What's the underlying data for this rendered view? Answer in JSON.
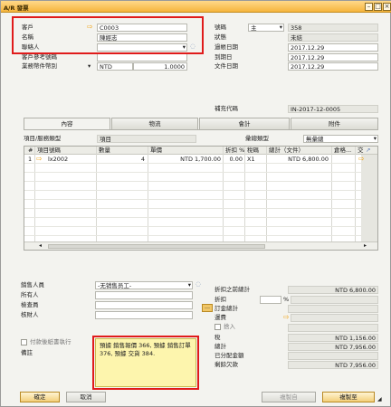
{
  "window": {
    "title": "A/R 發票"
  },
  "header_left": [
    {
      "label": "客戶",
      "value": "C0003"
    },
    {
      "label": "名稱",
      "value": "陳經志"
    },
    {
      "label": "聯絡人",
      "value": ""
    },
    {
      "label": "客戶參考號碼",
      "value": ""
    },
    {
      "label": "業務幣件幣別",
      "currency": "NTD",
      "rate": "1.0000"
    }
  ],
  "header_right": [
    {
      "label": "號碼",
      "series": "主",
      "value": "358"
    },
    {
      "label": "狀態",
      "value": "未結"
    },
    {
      "label": "過帳日期",
      "value": "2017.12.29"
    },
    {
      "label": "到期日",
      "value": "2017.12.29"
    },
    {
      "label": "文件日期",
      "value": "2017.12.29"
    }
  ],
  "reference": {
    "label": "補充代碼",
    "value": "IN-2017-12-0005"
  },
  "tabs": [
    "內容",
    "物流",
    "會計",
    "附件"
  ],
  "item_row": {
    "type_label": "項目/服務類型",
    "type_value": "項目",
    "summary_label": "彙總類型",
    "summary_value": "無彙總"
  },
  "grid": {
    "columns": [
      "#",
      "項目號碼",
      "數量",
      "單價",
      "折扣 %",
      "稅碼",
      "總計（文件）",
      "倉格...",
      "交"
    ],
    "rows": [
      {
        "no": "1",
        "item": "lx2002",
        "qty": "4",
        "price": "NTD 1,700.00",
        "discount": "0.00",
        "tax": "X1",
        "total": "NTD 6,800.00"
      }
    ]
  },
  "footer_left": {
    "sales_employee_label": "銷售人員",
    "sales_employee_value": "-无销售员工-",
    "owner_label": "所有人",
    "checker_label": "檢查員",
    "approver_label": "核財人",
    "payment_label": "付款後紙書執行",
    "remarks_label": "備註",
    "remarks_text": "預據 銷售報價 366, 預據 銷售訂單 376, 預據 交貨 384."
  },
  "totals": [
    {
      "label": "折扣之前總計",
      "value": "NTD 6,800.00"
    },
    {
      "label": "折扣",
      "value": ""
    },
    {
      "label": "訂金總計",
      "value": ""
    },
    {
      "label": "運費",
      "value": ""
    },
    {
      "label": "捨入",
      "value": ""
    },
    {
      "label": "稅",
      "value": "NTD 1,156.00"
    },
    {
      "label": "總計",
      "value": "NTD 7,956.00"
    },
    {
      "label": "已分配金額",
      "value": ""
    },
    {
      "label": "剩餘欠款",
      "value": "NTD 7,956.00"
    }
  ],
  "discount_percent": "%",
  "buttons": {
    "ok": "確定",
    "cancel": "取消",
    "copy_from": "複製自",
    "copy_to": "複製至"
  }
}
